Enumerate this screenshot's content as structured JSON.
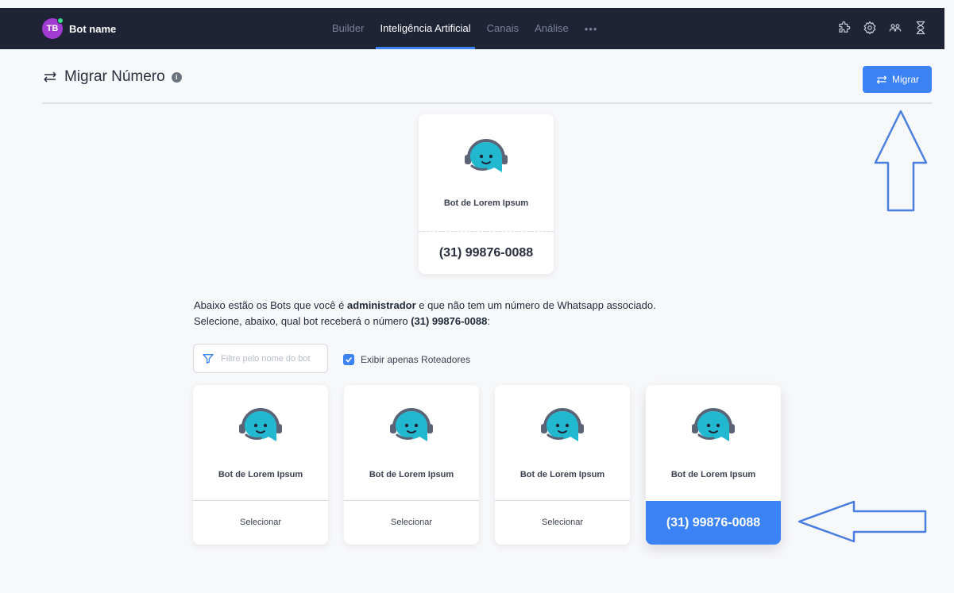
{
  "topbar": {
    "avatar_initials": "TB",
    "bot_name": "Bot name",
    "nav": [
      "Builder",
      "Inteligência Artificial",
      "Canais",
      "Análise"
    ],
    "nav_more": "•••",
    "icons": [
      "puzzle-icon",
      "gear-icon",
      "users-icon",
      "hourglass-icon"
    ]
  },
  "header": {
    "title": "Migrar Número",
    "info": "i",
    "migrar_button": "Migrar"
  },
  "source_bot": {
    "name": "Bot de Lorem Ipsum",
    "number": "(31) 99876-0088"
  },
  "description": {
    "line1_a": "Abaixo estão os Bots que você é ",
    "line1_b": "administrador",
    "line1_c": " e que não tem um número de Whatsapp associado.",
    "line2_a": "Selecione, abaixo, qual bot receberá o número ",
    "line2_b": "(31) 99876-0088",
    "line2_c": ":"
  },
  "filter": {
    "placeholder": "Filtre pelo nome do bot",
    "checkbox_label": "Exibir apenas Roteadores",
    "checked": true
  },
  "bots": [
    {
      "name": "Bot de Lorem Ipsum",
      "action": "Selecionar"
    },
    {
      "name": "Bot de Lorem Ipsum",
      "action": "Selecionar"
    },
    {
      "name": "Bot de Lorem Ipsum",
      "action": "Selecionar"
    },
    {
      "name": "Bot de Lorem Ipsum",
      "action": "(31) 99876-0088"
    }
  ],
  "colors": {
    "nav_bg": "#1e2436",
    "accent": "#3b82f6",
    "bot_teal": "#22b8cf",
    "avatar": "#a23bd1"
  }
}
